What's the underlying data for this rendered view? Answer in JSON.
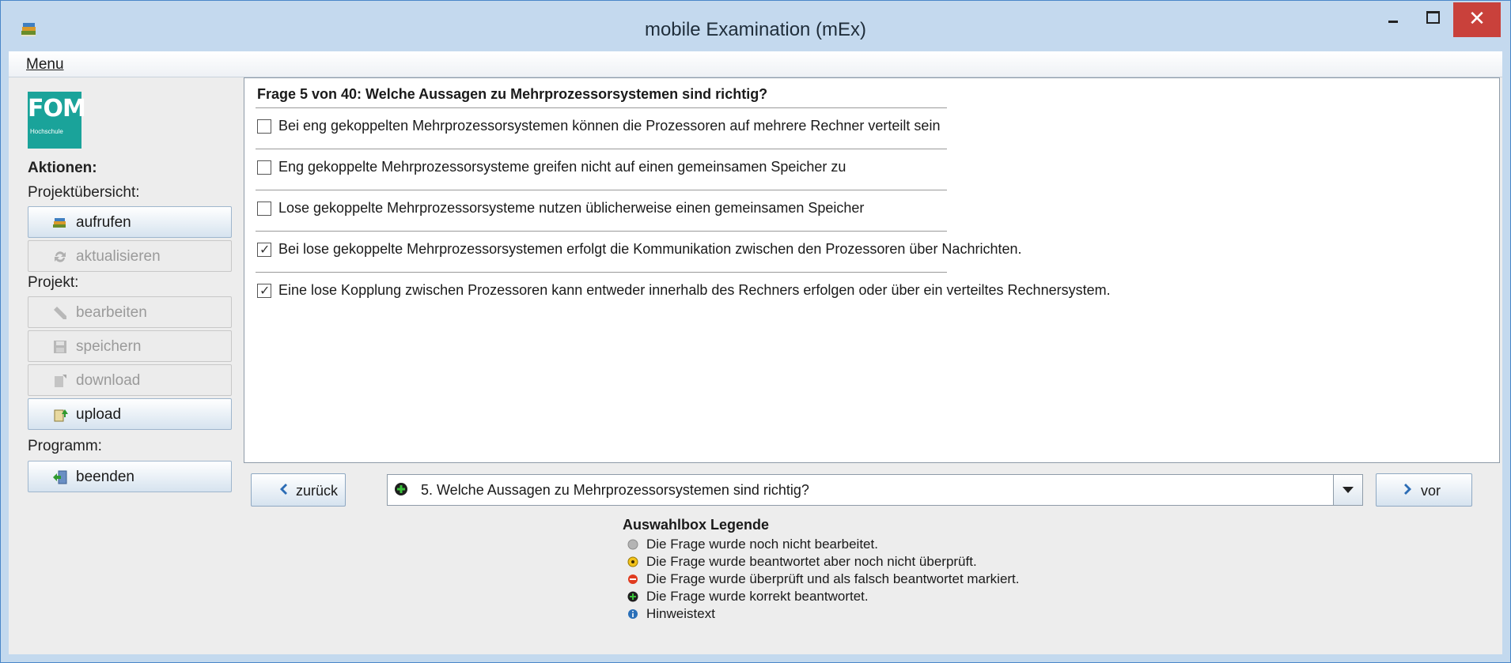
{
  "window": {
    "title": "mobile Examination (mEx)"
  },
  "menubar": {
    "menu_label": "Menu"
  },
  "sidebar": {
    "logo_text": "FOM",
    "logo_subtext": "Hochschule",
    "actions_heading": "Aktionen:",
    "project_overview_label": "Projektübersicht:",
    "project_label": "Projekt:",
    "program_label": "Programm:",
    "buttons": {
      "aufrufen": "aufrufen",
      "aktualisieren": "aktualisieren",
      "bearbeiten": "bearbeiten",
      "speichern": "speichern",
      "download": "download",
      "upload": "upload",
      "beenden": "beenden"
    }
  },
  "question": {
    "title": "Frage 5 von 40: Welche Aussagen zu Mehrprozessorsystemen sind richtig?",
    "options": [
      {
        "text": "Bei eng gekoppelten Mehrprozessorsystemen können die Prozessoren auf mehrere Rechner verteilt sein",
        "checked": false
      },
      {
        "text": "Eng gekoppelte Mehrprozessorsysteme greifen nicht auf einen gemeinsamen Speicher zu",
        "checked": false
      },
      {
        "text": "Lose gekoppelte Mehrprozessorsysteme nutzen üblicherweise einen gemeinsamen Speicher",
        "checked": false
      },
      {
        "text": "Bei lose gekoppelte Mehrprozessorsystemen erfolgt die Kommunikation zwischen den Prozessoren über Nachrichten.",
        "checked": true
      },
      {
        "text": "Eine lose Kopplung zwischen Prozessoren kann entweder innerhalb des Rechners erfolgen oder über ein verteiltes Rechnersystem.",
        "checked": true
      }
    ]
  },
  "navigation": {
    "back_label": "zurück",
    "forward_label": "vor",
    "selected_question": "5. Welche Aussagen zu Mehrprozessorsystemen sind richtig?",
    "selected_status_icon": "plus-green-icon"
  },
  "legend": {
    "title": "Auswahlbox Legende",
    "items": [
      {
        "icon": "gray-dot-icon",
        "color": "#b4b4b4",
        "text": "Die Frage wurde noch nicht bearbeitet."
      },
      {
        "icon": "yellow-dot-icon",
        "color": "#f2c21a",
        "text": "Die Frage wurde beantwortet aber noch nicht überprüft."
      },
      {
        "icon": "red-minus-icon",
        "color": "#e03a1e",
        "text": "Die Frage wurde überprüft und als falsch beantwortet markiert."
      },
      {
        "icon": "green-plus-icon",
        "color": "#1e8a1e",
        "text": "Die Frage wurde korrekt beantwortet."
      },
      {
        "icon": "blue-info-icon",
        "color": "#2a6fb8",
        "text": "Hinweistext"
      }
    ]
  }
}
